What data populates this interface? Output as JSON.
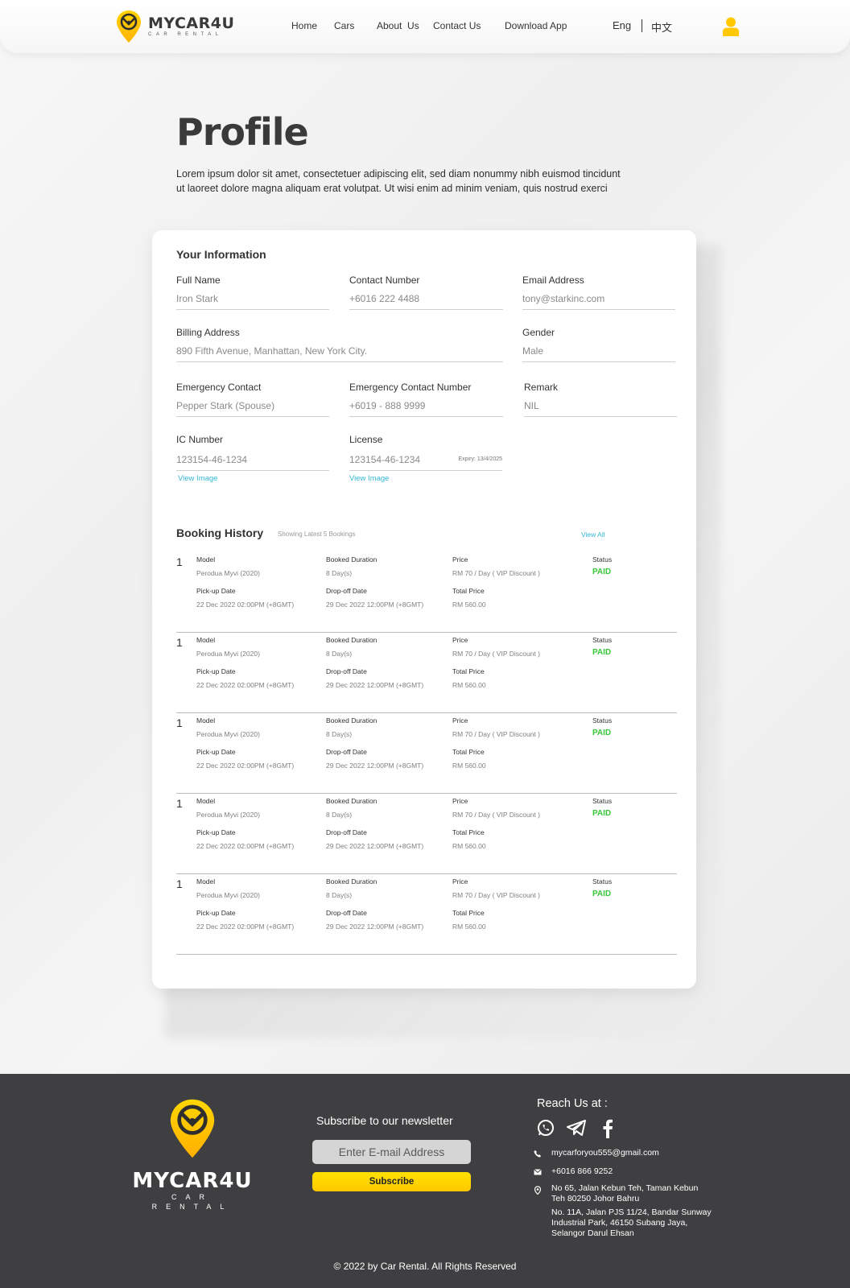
{
  "brand": {
    "name": "MYCAR4U",
    "tagline": "CAR RENTAL"
  },
  "nav": [
    {
      "label": "Home"
    },
    {
      "label": "Cars"
    },
    {
      "label": "About  Us"
    },
    {
      "label": "Contact Us"
    },
    {
      "label": "Download App"
    }
  ],
  "lang": {
    "eng": "Eng",
    "zh": "中文"
  },
  "page": {
    "title": "Profile",
    "intro_line1": "Lorem ipsum dolor sit amet, consectetuer adipiscing elit, sed diam nonummy nibh euismod tincidunt",
    "intro_line2": "ut laoreet dolore magna aliquam erat volutpat. Ut wisi enim ad minim veniam, quis nostrud exerci"
  },
  "info": {
    "title": "Your Information",
    "full_name": {
      "label": "Full Name",
      "value": "Iron Stark"
    },
    "contact_number": {
      "label": "Contact Number",
      "value": "+6016 222 4488"
    },
    "email": {
      "label": "Email Address",
      "value": "tony@starkinc.com"
    },
    "billing_address": {
      "label": "Billing Address",
      "value": "890 Fifth Avenue, Manhattan, New York City."
    },
    "gender": {
      "label": "Gender",
      "value": "Male"
    },
    "emergency_contact": {
      "label": "Emergency Contact",
      "value": "Pepper Stark (Spouse)"
    },
    "emergency_number": {
      "label": "Emergency Contact Number",
      "value": "+6019 - 888 9999"
    },
    "remark": {
      "label": "Remark",
      "value": "NIL"
    },
    "ic_number": {
      "label": "IC Number",
      "value": "123154-46-1234",
      "link": "View Image"
    },
    "license": {
      "label": "License",
      "value": "123154-46-1234",
      "expiry": "Expiry: 13/4/2025",
      "link": "View Image"
    }
  },
  "booking": {
    "title": "Booking History",
    "subtitle": "Showing Latest 5 Bookings",
    "view_all": "View All",
    "labels": {
      "model": "Model",
      "duration": "Booked Duration",
      "price": "Price",
      "status": "Status",
      "pickup": "Pick-up Date",
      "dropoff": "Drop-off Date",
      "total": "Total Price"
    },
    "rows": [
      {
        "num": "1",
        "model": "Perodua Myvi (2020)",
        "duration": "8 Day(s)",
        "price": "RM 70 / Day ( VIP Discount )",
        "status": "PAID",
        "pickup": "22 Dec 2022 02:00PM (+8GMT)",
        "dropoff": "29 Dec 2022 12:00PM (+8GMT)",
        "total": "RM 560.00"
      },
      {
        "num": "1",
        "model": "Perodua Myvi (2020)",
        "duration": "8 Day(s)",
        "price": "RM 70 / Day ( VIP Discount )",
        "status": "PAID",
        "pickup": "22 Dec 2022 02:00PM (+8GMT)",
        "dropoff": "29 Dec 2022 12:00PM (+8GMT)",
        "total": "RM 560.00"
      },
      {
        "num": "1",
        "model": "Perodua Myvi (2020)",
        "duration": "8 Day(s)",
        "price": "RM 70 / Day ( VIP Discount )",
        "status": "PAID",
        "pickup": "22 Dec 2022 02:00PM (+8GMT)",
        "dropoff": "29 Dec 2022 12:00PM (+8GMT)",
        "total": "RM 560.00"
      },
      {
        "num": "1",
        "model": "Perodua Myvi (2020)",
        "duration": "8 Day(s)",
        "price": "RM 70 / Day ( VIP Discount )",
        "status": "PAID",
        "pickup": "22 Dec 2022 02:00PM (+8GMT)",
        "dropoff": "29 Dec 2022 12:00PM (+8GMT)",
        "total": "RM 560.00"
      },
      {
        "num": "1",
        "model": "Perodua Myvi (2020)",
        "duration": "8 Day(s)",
        "price": "RM 70 / Day ( VIP Discount )",
        "status": "PAID",
        "pickup": "22 Dec 2022 02:00PM (+8GMT)",
        "dropoff": "29 Dec 2022 12:00PM (+8GMT)",
        "total": "RM 560.00"
      }
    ]
  },
  "footer": {
    "newsletter_title": "Subscribe to our newsletter",
    "email_placeholder": "Enter E-mail Address",
    "subscribe_label": "Subscribe",
    "reach_title": "Reach Us at :",
    "email": "mycarforyou555@gmail.com",
    "phone": "+6016 866 9252",
    "address1_line1": "No 65, Jalan Kebun Teh, Taman Kebun",
    "address1_line2": "Teh 80250 Johor Bahru",
    "address2_line1": "No. 11A, Jalan PJS 11/24, Bandar Sunway",
    "address2_line2": "Industrial Park, 46150 Subang Jaya,",
    "address2_line3": "Selangor Darul Ehsan",
    "copyright": "© 2022 by Car Rental. All Rights Reserved"
  },
  "colors": {
    "accent": "#ffc800",
    "link": "#35b6d6",
    "paid": "#37c837",
    "footer_bg": "#3f3f41"
  },
  "icons": [
    "logo-pin-icon",
    "user-icon",
    "whatsapp-icon",
    "telegram-icon",
    "facebook-icon",
    "phone-icon",
    "mail-icon",
    "location-icon"
  ]
}
